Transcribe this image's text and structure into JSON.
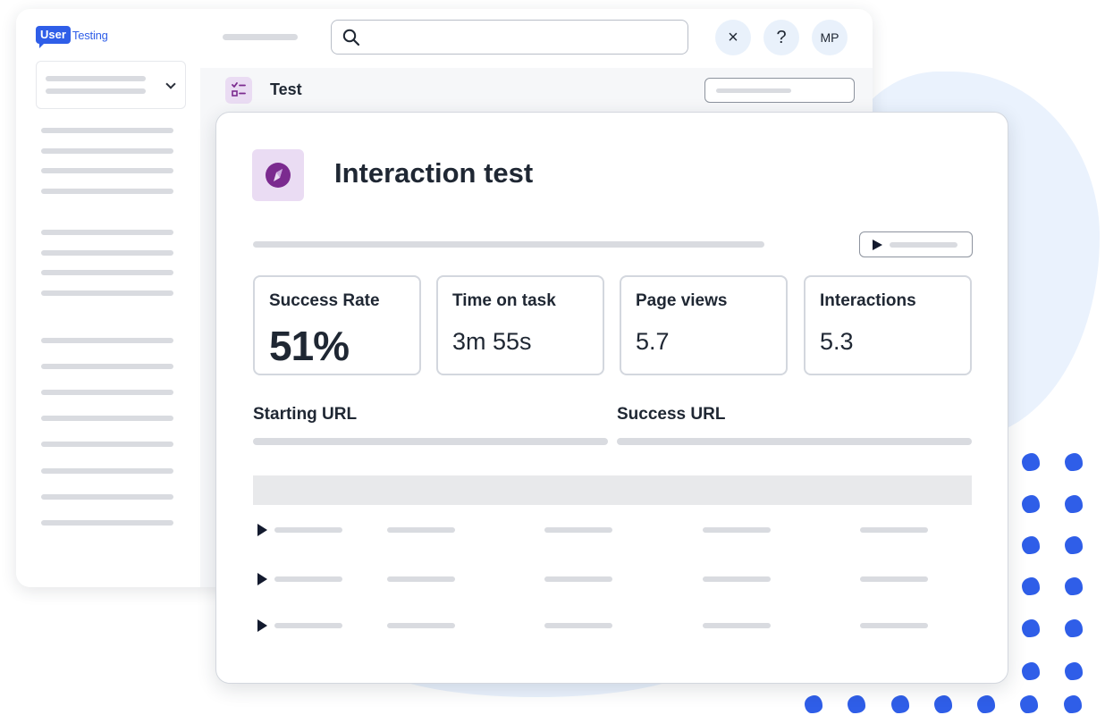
{
  "logo": {
    "part1": "User",
    "part2": "Testing"
  },
  "header": {
    "close_glyph": "×",
    "help_glyph": "?",
    "avatar_initials": "MP"
  },
  "subheader": {
    "title": "Test"
  },
  "card": {
    "title": "Interaction test",
    "metrics": [
      {
        "label": "Success Rate",
        "value": "51%"
      },
      {
        "label": "Time on task",
        "value": "3m 55s"
      },
      {
        "label": "Page views",
        "value": "5.7"
      },
      {
        "label": "Interactions",
        "value": "5.3"
      }
    ],
    "starting_url_label": "Starting URL",
    "success_url_label": "Success URL"
  },
  "icons": {
    "search": "search-icon",
    "close": "close-icon",
    "help": "help-icon",
    "test": "checklist-icon",
    "interaction": "compass-icon",
    "play": "play-icon"
  },
  "colors": {
    "brand": "#2f5ee8",
    "accent_bg": "#eadcf3",
    "icon_purple": "#7b2a8f",
    "text": "#1f2733"
  }
}
